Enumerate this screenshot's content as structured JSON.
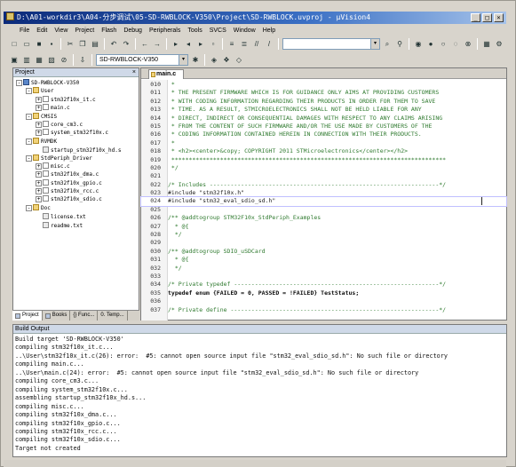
{
  "window": {
    "title": "D:\\A01-workdir3\\A04-分步调试\\05-SD-RWBLOCK-V350\\Project\\SD-RWBLOCK.uvproj - µVision4",
    "buttons": [
      "_",
      "□",
      "×"
    ]
  },
  "menu": [
    "File",
    "Edit",
    "View",
    "Project",
    "Flash",
    "Debug",
    "Peripherals",
    "Tools",
    "SVCS",
    "Window",
    "Help"
  ],
  "toolbar2": {
    "target": "SD-RWBLOCK-V350"
  },
  "project_panel": {
    "title": "Project",
    "close": "×",
    "tree": [
      {
        "level": 0,
        "type": "proj",
        "label": "SD-RWBLOCK-V350",
        "expand": "-"
      },
      {
        "level": 1,
        "type": "folder",
        "label": "User",
        "expand": "-"
      },
      {
        "level": 2,
        "type": "file",
        "label": "stm32f10x_it.c",
        "expand": "+"
      },
      {
        "level": 2,
        "type": "file",
        "label": "main.c",
        "expand": "+"
      },
      {
        "level": 1,
        "type": "folder",
        "label": "CMSIS",
        "expand": "-"
      },
      {
        "level": 2,
        "type": "file",
        "label": "core_cm3.c",
        "expand": "+"
      },
      {
        "level": 2,
        "type": "file",
        "label": "system_stm32f10x.c",
        "expand": "+"
      },
      {
        "level": 1,
        "type": "folder",
        "label": "RVMDK",
        "expand": "-"
      },
      {
        "level": 2,
        "type": "asm",
        "label": "startup_stm32f10x_hd.s",
        "expand": ""
      },
      {
        "level": 1,
        "type": "folder",
        "label": "StdPeriph_Driver",
        "expand": "-"
      },
      {
        "level": 2,
        "type": "file",
        "label": "misc.c",
        "expand": "+"
      },
      {
        "level": 2,
        "type": "file",
        "label": "stm32f10x_dma.c",
        "expand": "+"
      },
      {
        "level": 2,
        "type": "file",
        "label": "stm32f10x_gpio.c",
        "expand": "+"
      },
      {
        "level": 2,
        "type": "file",
        "label": "stm32f10x_rcc.c",
        "expand": "+"
      },
      {
        "level": 2,
        "type": "file",
        "label": "stm32f10x_sdio.c",
        "expand": "+"
      },
      {
        "level": 1,
        "type": "folder",
        "label": "Doc",
        "expand": "-"
      },
      {
        "level": 2,
        "type": "asm",
        "label": "license.txt",
        "expand": ""
      },
      {
        "level": 2,
        "type": "asm",
        "label": "readme.txt",
        "expand": ""
      }
    ],
    "tabs": [
      "Project",
      "Books",
      "{} Func...",
      "0. Temp..."
    ]
  },
  "editor": {
    "tab": "main.c",
    "lines": [
      {
        "n": "010",
        "t": " *",
        "c": "cmt"
      },
      {
        "n": "011",
        "t": " * THE PRESENT FIRMWARE WHICH IS FOR GUIDANCE ONLY AIMS AT PROVIDING CUSTOMERS",
        "c": "cmt"
      },
      {
        "n": "012",
        "t": " * WITH CODING INFORMATION REGARDING THEIR PRODUCTS IN ORDER FOR THEM TO SAVE",
        "c": "cmt"
      },
      {
        "n": "013",
        "t": " * TIME. AS A RESULT, STMICROELECTRONICS SHALL NOT BE HELD LIABLE FOR ANY",
        "c": "cmt"
      },
      {
        "n": "014",
        "t": " * DIRECT, INDIRECT OR CONSEQUENTIAL DAMAGES WITH RESPECT TO ANY CLAIMS ARISING",
        "c": "cmt"
      },
      {
        "n": "015",
        "t": " * FROM THE CONTENT OF SUCH FIRMWARE AND/OR THE USE MADE BY CUSTOMERS OF THE",
        "c": "cmt"
      },
      {
        "n": "016",
        "t": " * CODING INFORMATION CONTAINED HEREIN IN CONNECTION WITH THEIR PRODUCTS.",
        "c": "cmt"
      },
      {
        "n": "017",
        "t": " *",
        "c": "cmt"
      },
      {
        "n": "018",
        "t": " * <h2><center>&copy; COPYRIGHT 2011 STMicroelectronics</center></h2>",
        "c": "cmt"
      },
      {
        "n": "019",
        "t": " *******************************************************************************",
        "c": "cmt"
      },
      {
        "n": "020",
        "t": " */",
        "c": "cmt"
      },
      {
        "n": "021",
        "t": "",
        "c": "code"
      },
      {
        "n": "022",
        "t": "/* Includes ------------------------------------------------------------------*/",
        "c": "cmt"
      },
      {
        "n": "023",
        "t": "#include \"stm32f10x.h\"",
        "c": "pp"
      },
      {
        "n": "024",
        "t": "#include \"stm32_eval_sdio_sd.h\"",
        "c": "pp",
        "hl": true
      },
      {
        "n": "025",
        "t": "",
        "c": "code"
      },
      {
        "n": "026",
        "t": "/** @addtogroup STM32F10x_StdPeriph_Examples",
        "c": "cmt"
      },
      {
        "n": "027",
        "t": "  * @{",
        "c": "cmt"
      },
      {
        "n": "028",
        "t": "  */",
        "c": "cmt"
      },
      {
        "n": "029",
        "t": "",
        "c": "code"
      },
      {
        "n": "030",
        "t": "/** @addtogroup SDIO_uSDCard",
        "c": "cmt"
      },
      {
        "n": "031",
        "t": "  * @{",
        "c": "cmt"
      },
      {
        "n": "032",
        "t": "  */",
        "c": "cmt"
      },
      {
        "n": "033",
        "t": "",
        "c": "code"
      },
      {
        "n": "034",
        "t": "/* Private typedef -----------------------------------------------------------*/",
        "c": "cmt"
      },
      {
        "n": "035",
        "t": "typedef enum {FAILED = 0, PASSED = !FAILED} TestStatus;",
        "c": "kw"
      },
      {
        "n": "036",
        "t": "",
        "c": "code"
      },
      {
        "n": "037",
        "t": "/* Private define ------------------------------------------------------------*/",
        "c": "cmt"
      }
    ]
  },
  "build_output": {
    "title": "Build Output",
    "lines": [
      "Build target 'SD-RWBLOCK-V350'",
      "compiling stm32f10x_it.c...",
      "..\\User\\stm32f10x_it.c(26): error:  #5: cannot open source input file \"stm32_eval_sdio_sd.h\": No such file or directory",
      "compiling main.c...",
      "..\\User\\main.c(24): error:  #5: cannot open source input file \"stm32_eval_sdio_sd.h\": No such file or directory",
      "compiling core_cm3.c...",
      "compiling system_stm32f10x.c...",
      "assembling startup_stm32f10x_hd.s...",
      "compiling misc.c...",
      "compiling stm32f10x_dma.c...",
      "compiling stm32f10x_gpio.c...",
      "compiling stm32f10x_rcc.c...",
      "compiling stm32f10x_sdio.c...",
      "Target not created"
    ]
  }
}
